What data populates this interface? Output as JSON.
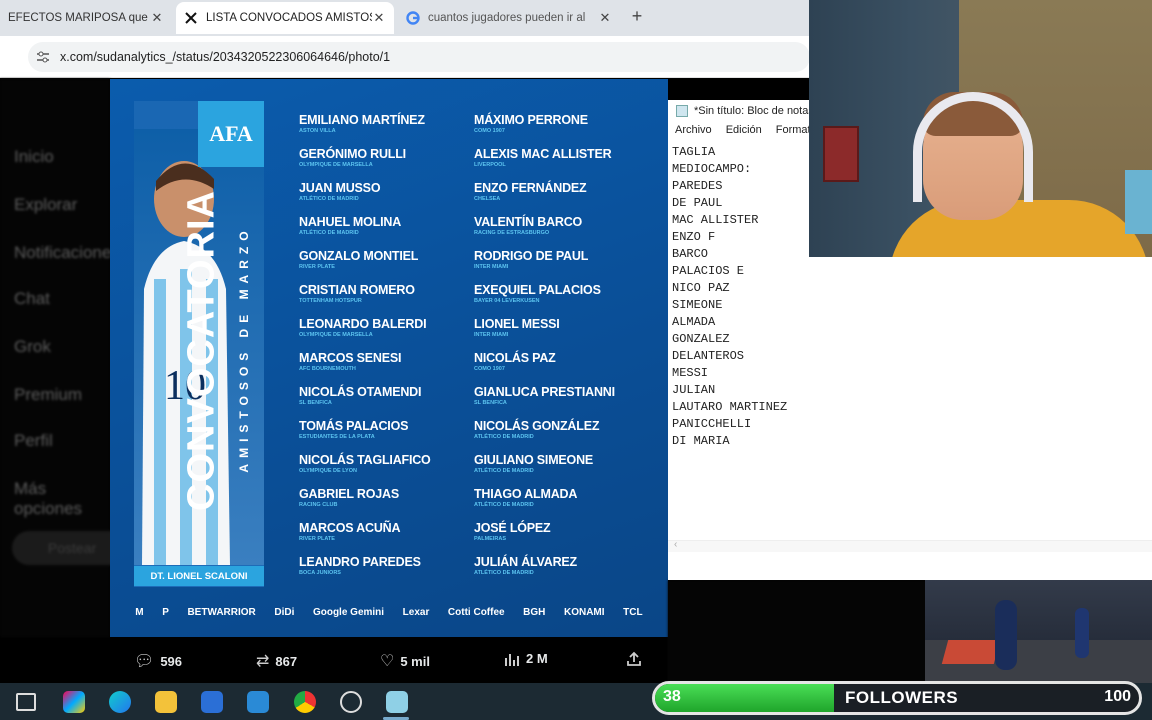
{
  "browser": {
    "tabs": [
      {
        "label": "EFECTOS MARIPOSA que al",
        "favicon": "tab-favicon"
      },
      {
        "label": "LISTA CONVOCADOS AMISTOS",
        "favicon": "x-logo-icon"
      },
      {
        "label": "cuantos jugadores pueden ir al",
        "favicon": "google-icon"
      }
    ],
    "url": "x.com/sudanalytics_/status/2034320522306064646/photo/1"
  },
  "x_sidebar": [
    "Inicio",
    "Explorar",
    "Notificaciones",
    "Chat",
    "Grok",
    "Premium",
    "Perfil",
    "Más opciones"
  ],
  "x_post_button": "Postear",
  "graphic": {
    "title": "CONVOCATORIA",
    "subtitle": "AMISTOSOS DE MARZO",
    "badge": "AFA",
    "coach": "DT. LIONEL SCALONI",
    "players_left": [
      {
        "name": "EMILIANO MARTÍNEZ",
        "club": "ASTON VILLA"
      },
      {
        "name": "GERÓNIMO RULLI",
        "club": "OLYMPIQUE DE MARSELLA"
      },
      {
        "name": "JUAN MUSSO",
        "club": "ATLÉTICO DE MADRID"
      },
      {
        "name": "NAHUEL MOLINA",
        "club": "ATLÉTICO DE MADRID"
      },
      {
        "name": "GONZALO MONTIEL",
        "club": "RIVER PLATE"
      },
      {
        "name": "CRISTIAN ROMERO",
        "club": "TOTTENHAM HOTSPUR"
      },
      {
        "name": "LEONARDO BALERDI",
        "club": "OLYMPIQUE DE MARSELLA"
      },
      {
        "name": "MARCOS SENESI",
        "club": "AFC BOURNEMOUTH"
      },
      {
        "name": "NICOLÁS OTAMENDI",
        "club": "SL BENFICA"
      },
      {
        "name": "TOMÁS PALACIOS",
        "club": "ESTUDIANTES DE LA PLATA"
      },
      {
        "name": "NICOLÁS TAGLIAFICO",
        "club": "OLYMPIQUE DE LYON"
      },
      {
        "name": "GABRIEL ROJAS",
        "club": "RACING CLUB"
      },
      {
        "name": "MARCOS ACUÑA",
        "club": "RIVER PLATE"
      },
      {
        "name": "LEANDRO PAREDES",
        "club": "BOCA JUNIORS"
      }
    ],
    "players_right": [
      {
        "name": "MÁXIMO PERRONE",
        "club": "COMO 1907"
      },
      {
        "name": "ALEXIS MAC ALLISTER",
        "club": "LIVERPOOL"
      },
      {
        "name": "ENZO FERNÁNDEZ",
        "club": "CHELSEA"
      },
      {
        "name": "VALENTÍN BARCO",
        "club": "RACING DE ESTRASBURGO"
      },
      {
        "name": "RODRIGO DE PAUL",
        "club": "INTER MIAMI"
      },
      {
        "name": "EXEQUIEL PALACIOS",
        "club": "BAYER 04 LEVERKUSEN"
      },
      {
        "name": "LIONEL MESSI",
        "club": "INTER MIAMI"
      },
      {
        "name": "NICOLÁS PAZ",
        "club": "COMO 1907"
      },
      {
        "name": "GIANLUCA PRESTIANNI",
        "club": "SL BENFICA"
      },
      {
        "name": "NICOLÁS GONZÁLEZ",
        "club": "ATLÉTICO DE MADRID"
      },
      {
        "name": "GIULIANO SIMEONE",
        "club": "ATLÉTICO DE MADRID"
      },
      {
        "name": "THIAGO ALMADA",
        "club": "ATLÉTICO DE MADRID"
      },
      {
        "name": "JOSÉ LÓPEZ",
        "club": "PALMEIRAS"
      },
      {
        "name": "JULIÁN ÁLVAREZ",
        "club": "ATLÉTICO DE MADRID"
      }
    ],
    "sponsors": [
      "M",
      "P",
      "BETWARRIOR",
      "DiDi",
      "Google Gemini",
      "Lexar",
      "Cotti Coffee",
      "BGH",
      "KONAMI",
      "TCL"
    ]
  },
  "tweet_actions": {
    "replies": "596",
    "reposts": "867",
    "likes": "5 mil",
    "views": "2 M"
  },
  "notepad": {
    "title": "*Sin título: Bloc de notas",
    "menu": [
      "Archivo",
      "Edición",
      "Formato"
    ],
    "lines": [
      "TAGLIA",
      "MEDIOCAMPO:",
      "PAREDES",
      "DE PAUL",
      "MAC ALLISTER",
      "ENZO F",
      "BARCO",
      "PALACIOS E",
      "NICO PAZ",
      "SIMEONE",
      "ALMADA",
      "GONZALEZ",
      "DELANTEROS",
      "MESSI",
      "JULIAN",
      "LAUTARO MARTINEZ",
      "PANICCHELLI",
      "DI MARIA"
    ]
  },
  "followers_widget": {
    "current": "38",
    "label": "FOLLOWERS",
    "goal": "100",
    "progress": 0.38
  }
}
